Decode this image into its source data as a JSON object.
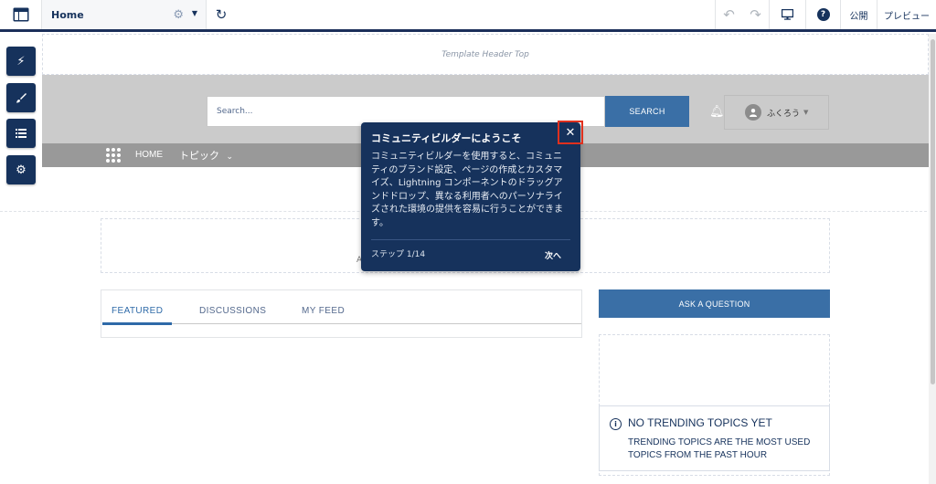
{
  "toolbar": {
    "page_name": "Home",
    "publish_label": "公開",
    "preview_label": "プレビュー",
    "help_label": "?"
  },
  "canvas": {
    "template_header": "Template Header Top",
    "search": {
      "placeholder": "Search...",
      "button_label": "SEARCH"
    },
    "user": {
      "name": "ふくろう"
    },
    "nav": {
      "home_label": "HOME",
      "topics_label": "トピック"
    },
    "banner_fragment": "A",
    "tabs": [
      {
        "label": "FEATURED",
        "active": true
      },
      {
        "label": "DISCUSSIONS",
        "active": false
      },
      {
        "label": "MY FEED",
        "active": false
      }
    ],
    "ask_button_label": "ASK A QUESTION",
    "trending": {
      "title": "NO TRENDING TOPICS YET",
      "description": "TRENDING TOPICS ARE THE MOST USED TOPICS FROM THE PAST HOUR"
    }
  },
  "popover": {
    "title": "コミュニティビルダーにようこそ",
    "body": "コミュニティビルダーを使用すると、コミュニティのブランド設定、ページの作成とカスタマイズ、Lightning コンポーネントのドラッグアンドドロップ、異なる利用者へのパーソナライズされた環境の提供を容易に行うことができます。",
    "step": "ステップ 1/14",
    "next_label": "次へ",
    "close_icon": "close-icon"
  },
  "side_panel": {
    "buttons": [
      "lightning-icon",
      "brush-icon",
      "list-icon",
      "gear-icon"
    ]
  },
  "colors": {
    "toolbar_border": "#1b2f5a",
    "popover_bg": "#16325c",
    "accent_blue": "#3a6fa6",
    "highlight_red": "#e0301e"
  }
}
